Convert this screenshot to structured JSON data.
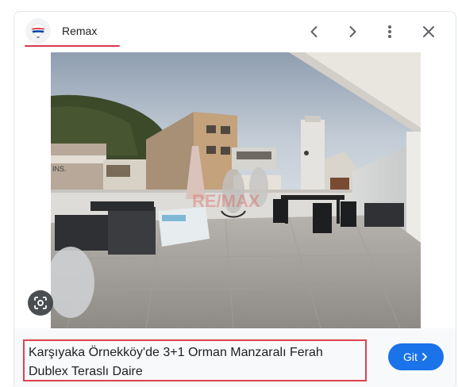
{
  "header": {
    "source_name": "Remax",
    "icons": {
      "logo": "remax-balloon-icon",
      "prev": "chevron-left-icon",
      "next": "chevron-right-icon",
      "more": "more-vert-icon",
      "close": "close-icon"
    }
  },
  "image": {
    "icon": "photo-of-rooftop-terrace",
    "watermark": "RE/MAX",
    "sign_text": "INS.",
    "lens_icon": "lens-search-icon"
  },
  "footer": {
    "title": "Karşıyaka Örnekköy'de 3+1 Orman Manzaralı Ferah Dublex Teraslı Daire",
    "visit_label": "Git",
    "visit_icon": "chevron-right-icon"
  },
  "colors": {
    "accent": "#1a73e8",
    "highlight": "#e0414f",
    "underline": "#d93a4c"
  }
}
